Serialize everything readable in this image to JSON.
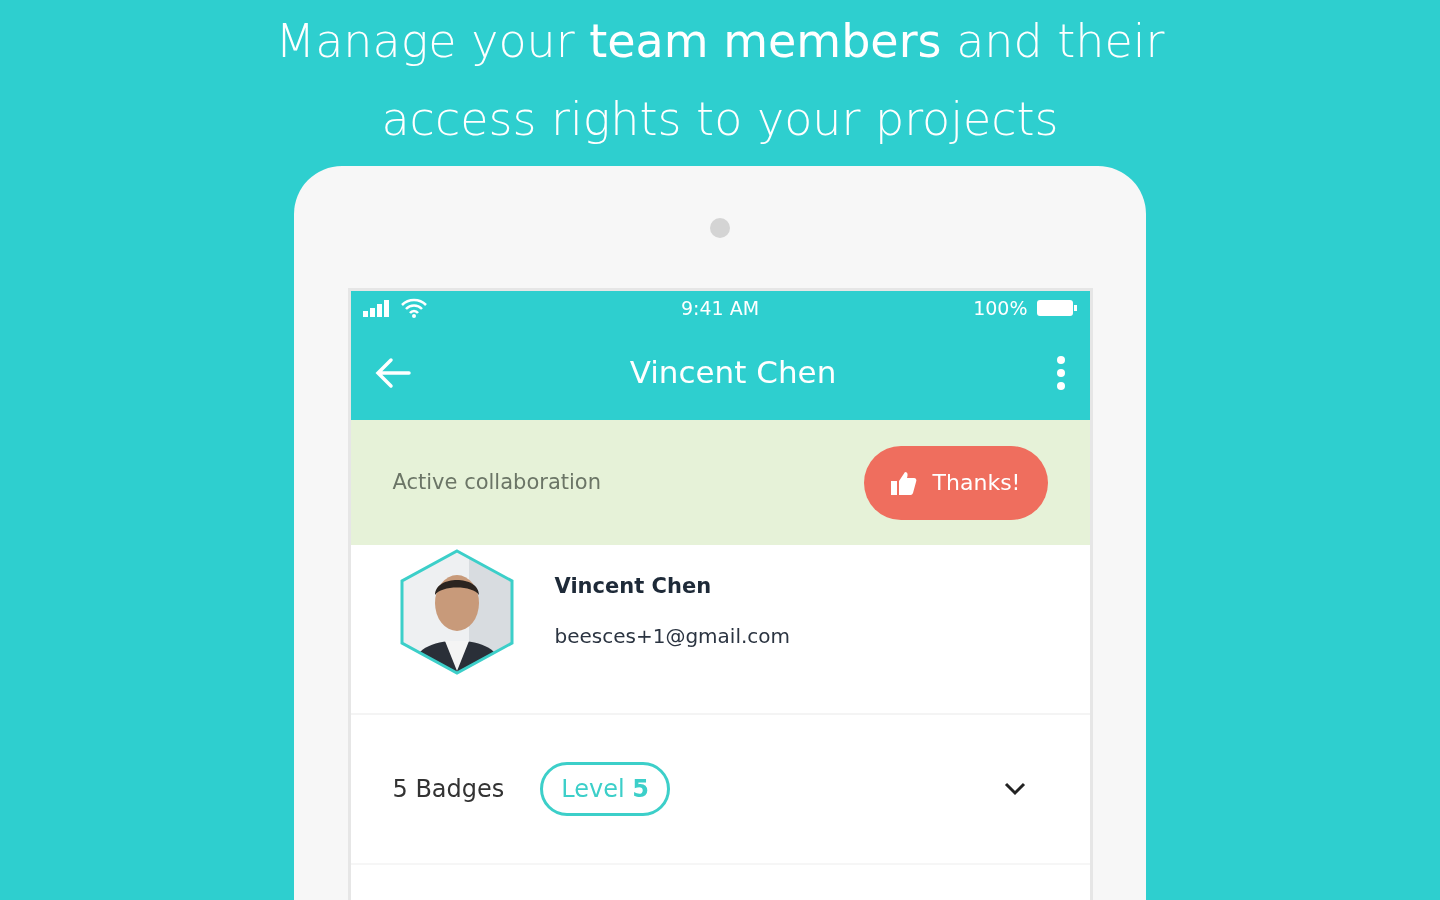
{
  "headline": "Manage your **team members** and their access rights to your projects",
  "status_bar": {
    "time": "9:41 AM",
    "battery": "100%"
  },
  "app_bar": {
    "title": "Vincent Chen"
  },
  "banner": {
    "label": "Active collaboration",
    "button": "Thanks!"
  },
  "profile": {
    "name": "Vincent Chen",
    "email": "beesces+1@gmail.com"
  },
  "badges_row": {
    "count": "5 Badges",
    "level": "Level **5**"
  }
}
